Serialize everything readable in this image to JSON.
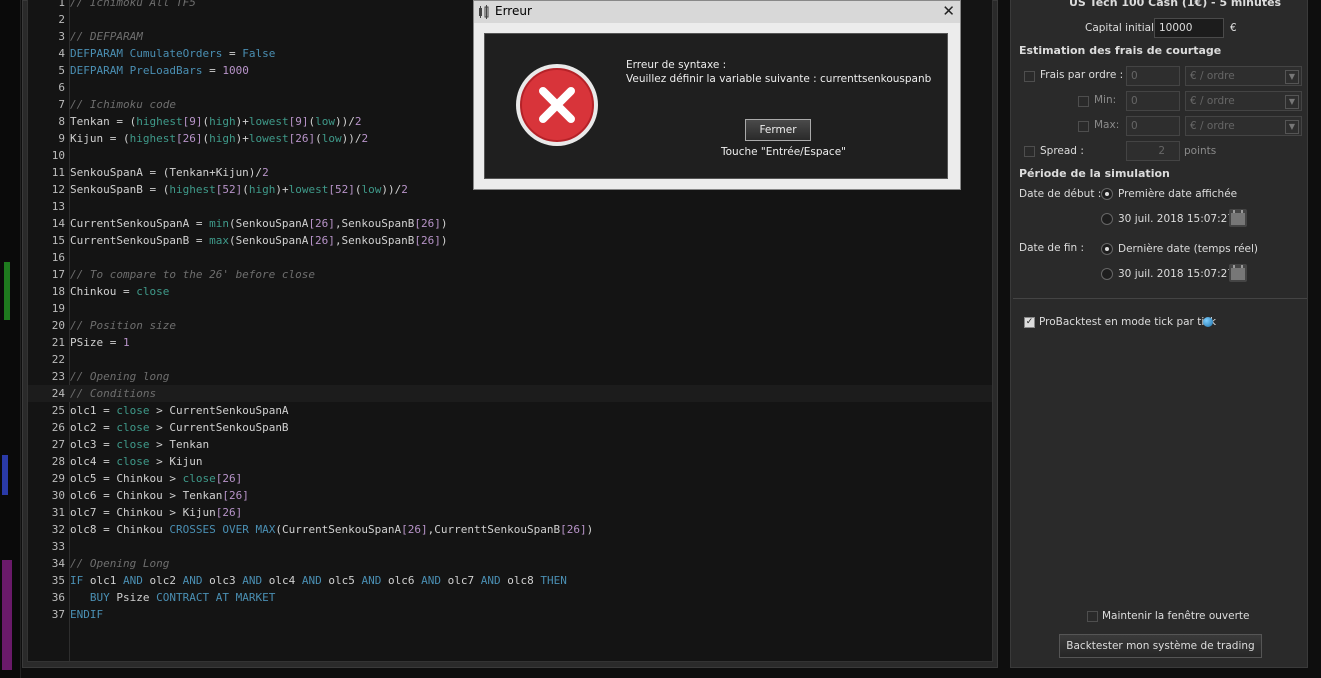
{
  "editor": {
    "lines": [
      {
        "n": "1",
        "t": [
          [
            "c",
            "// Ichimoku All TF5"
          ]
        ]
      },
      {
        "n": "2",
        "t": []
      },
      {
        "n": "3",
        "t": [
          [
            "c",
            "// DEFPARAM"
          ]
        ]
      },
      {
        "n": "4",
        "t": [
          [
            "k",
            "DEFPARAM"
          ],
          [
            "v",
            " "
          ],
          [
            "k",
            "CumulateOrders"
          ],
          [
            "v",
            " = "
          ],
          [
            "k",
            "False"
          ]
        ]
      },
      {
        "n": "5",
        "t": [
          [
            "k",
            "DEFPARAM"
          ],
          [
            "v",
            " "
          ],
          [
            "k",
            "PreLoadBars"
          ],
          [
            "v",
            " = "
          ],
          [
            "n",
            "1000"
          ]
        ]
      },
      {
        "n": "6",
        "t": []
      },
      {
        "n": "7",
        "t": [
          [
            "c",
            "// Ichimoku code"
          ]
        ]
      },
      {
        "n": "8",
        "t": [
          [
            "v",
            "Tenkan = ("
          ],
          [
            "f",
            "highest"
          ],
          [
            "n",
            "[9]"
          ],
          [
            "v",
            "("
          ],
          [
            "f",
            "high"
          ],
          [
            "v",
            ")+"
          ],
          [
            "f",
            "lowest"
          ],
          [
            "n",
            "[9]"
          ],
          [
            "v",
            "("
          ],
          [
            "f",
            "low"
          ],
          [
            "v",
            "))/"
          ],
          [
            "n",
            "2"
          ]
        ]
      },
      {
        "n": "9",
        "t": [
          [
            "v",
            "Kijun = ("
          ],
          [
            "f",
            "highest"
          ],
          [
            "n",
            "[26]"
          ],
          [
            "v",
            "("
          ],
          [
            "f",
            "high"
          ],
          [
            "v",
            ")+"
          ],
          [
            "f",
            "lowest"
          ],
          [
            "n",
            "[26]"
          ],
          [
            "v",
            "("
          ],
          [
            "f",
            "low"
          ],
          [
            "v",
            "))/"
          ],
          [
            "n",
            "2"
          ]
        ]
      },
      {
        "n": "10",
        "t": []
      },
      {
        "n": "11",
        "t": [
          [
            "v",
            "SenkouSpanA = (Tenkan+Kijun)/"
          ],
          [
            "n",
            "2"
          ]
        ]
      },
      {
        "n": "12",
        "t": [
          [
            "v",
            "SenkouSpanB = ("
          ],
          [
            "f",
            "highest"
          ],
          [
            "n",
            "[52]"
          ],
          [
            "v",
            "("
          ],
          [
            "f",
            "high"
          ],
          [
            "v",
            ")+"
          ],
          [
            "f",
            "lowest"
          ],
          [
            "n",
            "[52]"
          ],
          [
            "v",
            "("
          ],
          [
            "f",
            "low"
          ],
          [
            "v",
            "))/"
          ],
          [
            "n",
            "2"
          ]
        ]
      },
      {
        "n": "13",
        "t": []
      },
      {
        "n": "14",
        "t": [
          [
            "v",
            "CurrentSenkouSpanA = "
          ],
          [
            "f",
            "min"
          ],
          [
            "v",
            "(SenkouSpanA"
          ],
          [
            "n",
            "[26]"
          ],
          [
            "v",
            ",SenkouSpanB"
          ],
          [
            "n",
            "[26]"
          ],
          [
            "v",
            ")"
          ]
        ]
      },
      {
        "n": "15",
        "t": [
          [
            "v",
            "CurrentSenkouSpanB = "
          ],
          [
            "f",
            "max"
          ],
          [
            "v",
            "(SenkouSpanA"
          ],
          [
            "n",
            "[26]"
          ],
          [
            "v",
            ",SenkouSpanB"
          ],
          [
            "n",
            "[26]"
          ],
          [
            "v",
            ")"
          ]
        ]
      },
      {
        "n": "16",
        "t": []
      },
      {
        "n": "17",
        "t": [
          [
            "c",
            "// To compare to the 26' before close"
          ]
        ]
      },
      {
        "n": "18",
        "t": [
          [
            "v",
            "Chinkou = "
          ],
          [
            "f",
            "close"
          ]
        ]
      },
      {
        "n": "19",
        "t": []
      },
      {
        "n": "20",
        "t": [
          [
            "c",
            "// Position size"
          ]
        ]
      },
      {
        "n": "21",
        "t": [
          [
            "v",
            "PSize = "
          ],
          [
            "n",
            "1"
          ]
        ]
      },
      {
        "n": "22",
        "t": []
      },
      {
        "n": "23",
        "t": [
          [
            "c",
            "// Opening long"
          ]
        ]
      },
      {
        "n": "24",
        "t": [
          [
            "c",
            "// Conditions"
          ]
        ],
        "active": true
      },
      {
        "n": "25",
        "t": [
          [
            "v",
            "olc1 = "
          ],
          [
            "f",
            "close"
          ],
          [
            "v",
            " > CurrentSenkouSpanA"
          ]
        ]
      },
      {
        "n": "26",
        "t": [
          [
            "v",
            "olc2 = "
          ],
          [
            "f",
            "close"
          ],
          [
            "v",
            " > CurrentSenkouSpanB"
          ]
        ]
      },
      {
        "n": "27",
        "t": [
          [
            "v",
            "olc3 = "
          ],
          [
            "f",
            "close"
          ],
          [
            "v",
            " > Tenkan"
          ]
        ]
      },
      {
        "n": "28",
        "t": [
          [
            "v",
            "olc4 = "
          ],
          [
            "f",
            "close"
          ],
          [
            "v",
            " > Kijun"
          ]
        ]
      },
      {
        "n": "29",
        "t": [
          [
            "v",
            "olc5 = Chinkou > "
          ],
          [
            "f",
            "close"
          ],
          [
            "n",
            "[26]"
          ]
        ]
      },
      {
        "n": "30",
        "t": [
          [
            "v",
            "olc6 = Chinkou > Tenkan"
          ],
          [
            "n",
            "[26]"
          ]
        ]
      },
      {
        "n": "31",
        "t": [
          [
            "v",
            "olc7 = Chinkou > Kijun"
          ],
          [
            "n",
            "[26]"
          ]
        ]
      },
      {
        "n": "32",
        "t": [
          [
            "v",
            "olc8 = Chinkou "
          ],
          [
            "k",
            "CROSSES OVER"
          ],
          [
            "v",
            " "
          ],
          [
            "k",
            "MAX"
          ],
          [
            "v",
            "(CurrentSenkouSpanA"
          ],
          [
            "n",
            "[26]"
          ],
          [
            "v",
            ",CurrenttSenkouSpanB"
          ],
          [
            "n",
            "[26]"
          ],
          [
            "v",
            ")"
          ]
        ]
      },
      {
        "n": "33",
        "t": []
      },
      {
        "n": "34",
        "t": [
          [
            "c",
            "// Opening Long"
          ]
        ]
      },
      {
        "n": "35",
        "t": [
          [
            "k",
            "IF"
          ],
          [
            "v",
            " olc1 "
          ],
          [
            "k",
            "AND"
          ],
          [
            "v",
            " olc2 "
          ],
          [
            "k",
            "AND"
          ],
          [
            "v",
            " olc3 "
          ],
          [
            "k",
            "AND"
          ],
          [
            "v",
            " olc4 "
          ],
          [
            "k",
            "AND"
          ],
          [
            "v",
            " olc5 "
          ],
          [
            "k",
            "AND"
          ],
          [
            "v",
            " olc6 "
          ],
          [
            "k",
            "AND"
          ],
          [
            "v",
            " olc7 "
          ],
          [
            "k",
            "AND"
          ],
          [
            "v",
            " olc8 "
          ],
          [
            "k",
            "THEN"
          ]
        ]
      },
      {
        "n": "36",
        "t": [
          [
            "v",
            "   "
          ],
          [
            "k",
            "BUY"
          ],
          [
            "v",
            " Psize "
          ],
          [
            "k",
            "CONTRACT AT MARKET"
          ]
        ]
      },
      {
        "n": "37",
        "t": [
          [
            "k",
            "ENDIF"
          ]
        ]
      }
    ]
  },
  "panel": {
    "instrument_title": "US Tech 100 Cash (1€) - 5 minutes",
    "capital_label": "Capital initial :",
    "capital_value": "10000",
    "currency": "€",
    "fees_title": "Estimation des frais de courtage",
    "fee_per_order_label": "Frais par ordre :",
    "fee_per_order_value": "0",
    "unit_per_order": "€ / ordre",
    "min_label": "Min:",
    "min_value": "0",
    "max_label": "Max:",
    "max_value": "0",
    "spread_label": "Spread :",
    "spread_value": "2",
    "spread_unit": "points",
    "period_title": "Période de la simulation",
    "start_label": "Date de début :",
    "start_option_first": "Première date affichée",
    "start_option_date": "30 juil. 2018 15:07:27",
    "end_label": "Date de fin :",
    "end_option_last": "Dernière date (temps réel)",
    "end_option_date": "30 juil. 2018 15:07:27",
    "tick_mode_label": "ProBacktest en mode tick par tick",
    "keep_open_label": "Maintenir la fenêtre ouverte",
    "backtest_button": "Backtester mon système de trading"
  },
  "dialog": {
    "title": "Erreur",
    "close_glyph": "✕",
    "error_heading": "Erreur de syntaxe :",
    "error_message": "Veuillez définir la variable suivante : currenttsenkouspanb",
    "close_button": "Fermer",
    "key_hint": "Touche \"Entrée/Espace\""
  },
  "colors": {
    "keyword": "#4a8fb3",
    "comment": "#6e6e6e",
    "function": "#3f9a8a",
    "number": "#b894c9",
    "error_red": "#d8343a"
  }
}
